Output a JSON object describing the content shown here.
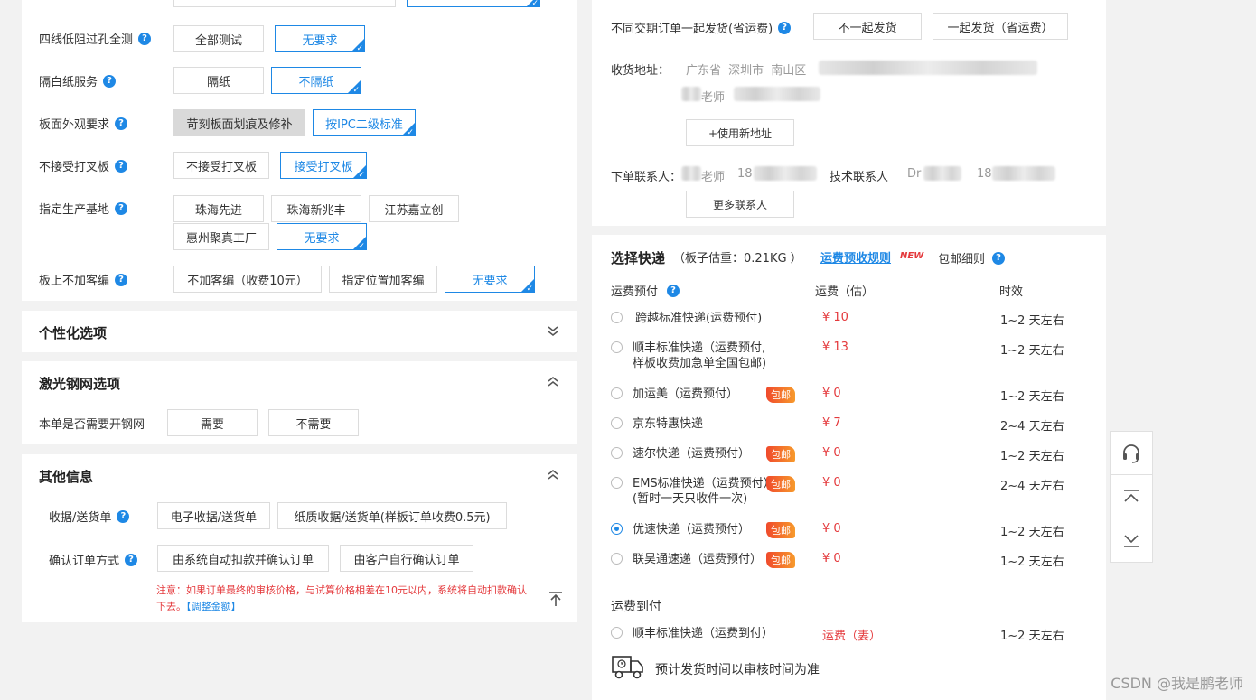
{
  "left": {
    "rows": [
      {
        "label": "四线低阻过孔全测",
        "options": [
          "全部测试",
          "无要求"
        ]
      },
      {
        "label": "隔白纸服务",
        "options": [
          "隔纸",
          "不隔纸"
        ]
      },
      {
        "label": "板面外观要求",
        "options": [
          "苛刻板面划痕及修补",
          "按IPC二级标准"
        ]
      },
      {
        "label": "不接受打叉板",
        "options": [
          "不接受打叉板",
          "接受打叉板"
        ]
      },
      {
        "label": "指定生产基地",
        "options": [
          "珠海先进",
          "珠海新兆丰",
          "江苏嘉立创",
          "惠州聚真工厂",
          "无要求"
        ]
      },
      {
        "label": "板上不加客编",
        "options": [
          "不加客编（收费10元）",
          "指定位置加客编",
          "无要求"
        ]
      }
    ],
    "personal": {
      "title": "个性化选项"
    },
    "laser": {
      "title": "激光钢网选项",
      "label": "本单是否需要开钢网",
      "options": [
        "需要",
        "不需要"
      ]
    },
    "other": {
      "title": "其他信息",
      "receipt_label": "收据/送货单",
      "receipt_options": [
        "电子收据/送货单",
        "纸质收据/送货单(样板订单收费0.5元)"
      ],
      "confirm_label": "确认订单方式",
      "confirm_options": [
        "由系统自动扣款并确认订单",
        "由客户自行确认订单"
      ],
      "note": "注意：如果订单最终的审核价格，与试算价格相差在10元以内，系统将自动扣款确认下去。",
      "note_link": "【调整金额】"
    }
  },
  "right": {
    "diff_label": "不同交期订单一起发货(省运费)",
    "diff_options": [
      "不一起发货",
      "一起发货（省运费）"
    ],
    "addr_label": "收货地址：",
    "addr_region": "广东省  深圳市  南山区",
    "addr_name": "老师",
    "new_addr_btn": "+使用新地址",
    "order_contact_label": "下单联系人：",
    "order_contact_name": "老师",
    "order_contact_phone": "18",
    "tech_contact_label": "技术联系人",
    "tech_contact_name": "Dr",
    "tech_contact_phone": "18",
    "more_contacts_btn": "更多联系人",
    "express_title": "选择快递",
    "weight": "（板子估重：0.21KG ）",
    "rule_link": "运费预收规则",
    "new_tag": "NEW",
    "free_detail": "包邮细则",
    "col_prepay": "运费预付",
    "col_fee": "运费（估）",
    "col_time": "时效",
    "free_badge": "包邮",
    "prepay_list": [
      {
        "name": "跨越标准快递(运费预付)",
        "price": "¥ 10",
        "time": "1~2 天左右"
      },
      {
        "name": "顺丰标准快递（运费预付,",
        "name2": "样板收费加急单全国包邮)",
        "price": "¥ 13",
        "time": "1~2 天左右"
      },
      {
        "name": "加运美（运费预付）",
        "price": "¥ 0",
        "time": "1~2 天左右"
      },
      {
        "name": "京东特惠快递",
        "price": "¥ 7",
        "time": "2~4 天左右"
      },
      {
        "name": "速尔快递（运费预付）",
        "price": "¥ 0",
        "time": "1~2 天左右"
      },
      {
        "name": "EMS标准快递（运费预付）",
        "name2": "(暂时一天只收件一次)",
        "price": "¥ 0",
        "time": "2~4 天左右"
      },
      {
        "name": "优速快递（运费预付）",
        "price": "¥ 0",
        "time": "1~2 天左右"
      },
      {
        "name": "联昊通速递（运费预付）",
        "price": "¥ 0",
        "time": "1~2 天左右"
      }
    ],
    "cod_title": "运费到付",
    "cod_item": {
      "name": "顺丰标准快递（运费到付）",
      "price": "运费（妻）",
      "time": "1~2 天左右"
    },
    "ship_note": "预计发货时间以审核时间为准"
  },
  "watermark": "CSDN @我是鹏老师"
}
